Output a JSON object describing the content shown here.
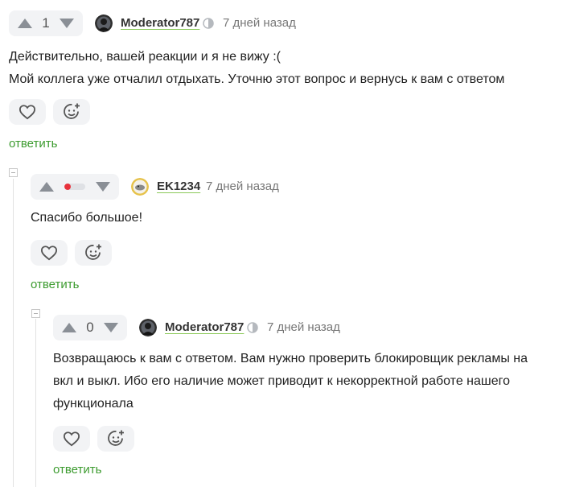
{
  "comments": [
    {
      "score": "1",
      "author": "Moderator787",
      "time": "7 дней назад",
      "text": "Действительно, вашей реакции и я не вижу :(\nМой коллега уже отчалил отдыхать. Уточню этот вопрос и вернусь к вам с ответом",
      "reply": "ответить"
    },
    {
      "rating_fraction": 0.3,
      "author": "EK1234",
      "time": "7 дней назад",
      "text": "Спасибо большое!",
      "reply": "ответить"
    },
    {
      "score": "0",
      "author": "Moderator787",
      "time": "7 дней назад",
      "text": "Возвращаюсь к вам с ответом. Вам нужно проверить блокировщик рекламы на\nвкл и выкл. Ибо его наличие может приводит к некорректной работе нашего\nфункционала",
      "reply": "ответить"
    }
  ],
  "colors": {
    "reply_link": "#3c9b2f",
    "author_underline": "#8ac858",
    "negative_rating": "#e8323c",
    "pill_background": "#f2f3f5"
  },
  "icons": [
    "arrow-up-icon",
    "arrow-down-icon",
    "moderator-badge-icon",
    "heart-icon",
    "add-reaction-icon",
    "collapse-icon"
  ]
}
